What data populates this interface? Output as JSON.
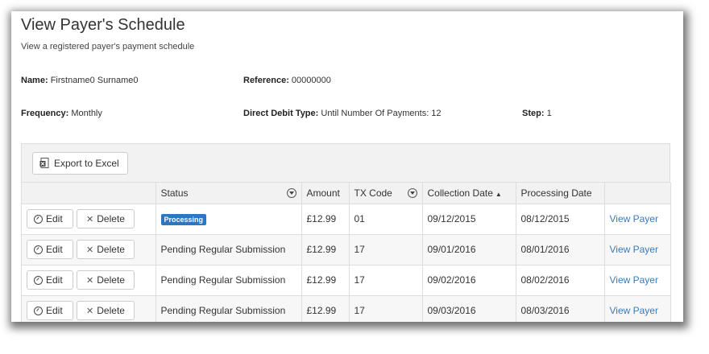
{
  "header": {
    "title": "View Payer's Schedule",
    "subtitle": "View a registered payer's payment schedule"
  },
  "details": {
    "name_label": "Name:",
    "name_value": "Firstname0 Surname0",
    "reference_label": "Reference:",
    "reference_value": "00000000",
    "frequency_label": "Frequency:",
    "frequency_value": "Monthly",
    "type_label": "Direct Debit Type:",
    "type_value": "Until Number Of Payments: 12",
    "step_label": "Step:",
    "step_value": "1"
  },
  "toolbar": {
    "export_label": "Export to Excel"
  },
  "grid": {
    "columns": [
      "",
      "Status",
      "Amount",
      "TX Code",
      "Collection Date",
      "Processing Date",
      ""
    ],
    "edit_label": "Edit",
    "delete_label": "Delete",
    "view_label": "View Payer",
    "rows": [
      {
        "status": "Processing",
        "amount": "£12.99",
        "tx_code": "01",
        "collection_date": "09/12/2015",
        "processing_date": "08/12/2015"
      },
      {
        "status": "Pending Regular Submission",
        "amount": "£12.99",
        "tx_code": "17",
        "collection_date": "09/01/2016",
        "processing_date": "08/01/2016"
      },
      {
        "status": "Pending Regular Submission",
        "amount": "£12.99",
        "tx_code": "17",
        "collection_date": "09/02/2016",
        "processing_date": "08/02/2016"
      },
      {
        "status": "Pending Regular Submission",
        "amount": "£12.99",
        "tx_code": "17",
        "collection_date": "09/03/2016",
        "processing_date": "08/03/2016"
      }
    ]
  },
  "colors": {
    "badge": "#2f76c0",
    "link": "#3a7ab8"
  }
}
